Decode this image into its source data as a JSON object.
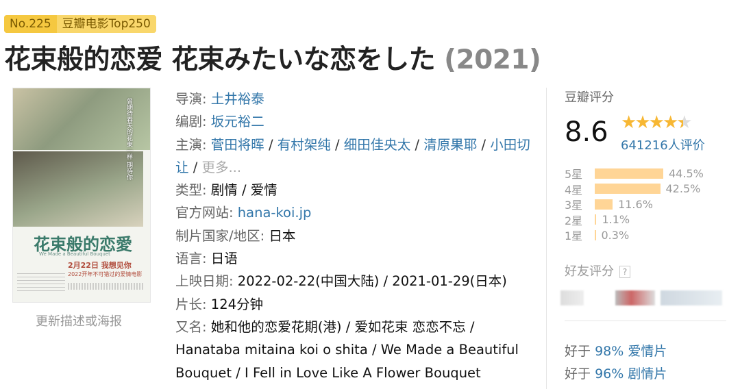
{
  "badge": {
    "rank": "No.225",
    "list": "豆瓣电影Top250"
  },
  "title": {
    "main": "花束般的恋爱 花束みたいな恋をした",
    "year": "(2021)"
  },
  "poster": {
    "title_text": "花束般的恋愛",
    "subtitle": "We Made a Beautiful Bouquet",
    "date_line": "2月22日 我想见你",
    "tagline": "2022开年不可错过的爱情电影",
    "side_text": "曾期待春天的花束一样 期待你",
    "update_link": "更新描述或海报"
  },
  "info": {
    "director_label": "导演",
    "director": "土井裕泰",
    "writer_label": "编剧",
    "writer": "坂元裕二",
    "cast_label": "主演",
    "cast": [
      "菅田将晖",
      "有村架纯",
      "细田佳央太",
      "清原果耶",
      "小田切让"
    ],
    "cast_more": "更多...",
    "genre_label": "类型",
    "genre": "剧情 / 爱情",
    "site_label": "官方网站",
    "site": "hana-koi.jp",
    "country_label": "制片国家/地区",
    "country": "日本",
    "language_label": "语言",
    "language": "日语",
    "release_label": "上映日期",
    "release": "2022-02-22(中国大陆) / 2021-01-29(日本)",
    "runtime_label": "片长",
    "runtime": "124分钟",
    "aka_label": "又名",
    "aka_line1": "她和他的恋爱花期(港) / 爱如花束 恋恋不忘 /",
    "aka_line2": "Hanataba mitaina koi o shita / We Made a Beautiful",
    "aka_line3": "Bouquet / I Fell in Love Like A Flower Bouquet"
  },
  "rating": {
    "label": "豆瓣评分",
    "score": "8.6",
    "stars": 4.5,
    "votes": "641216人评价",
    "distribution": [
      {
        "label": "5星",
        "percent": 44.5,
        "text": "44.5%"
      },
      {
        "label": "4星",
        "percent": 42.5,
        "text": "42.5%"
      },
      {
        "label": "3星",
        "percent": 11.6,
        "text": "11.6%"
      },
      {
        "label": "2星",
        "percent": 1.1,
        "text": "1.1%"
      },
      {
        "label": "1星",
        "percent": 0.3,
        "text": "0.3%"
      }
    ],
    "friends_label": "好友评分",
    "help_icon": "?",
    "better_than": [
      {
        "prefix": "好于",
        "pct": "98%",
        "genre": "爱情片"
      },
      {
        "prefix": "好于",
        "pct": "96%",
        "genre": "剧情片"
      }
    ]
  },
  "colors": {
    "link": "#3377aa",
    "star": "#f7b733",
    "bar": "#ffd596",
    "badge": "#f5c840"
  }
}
